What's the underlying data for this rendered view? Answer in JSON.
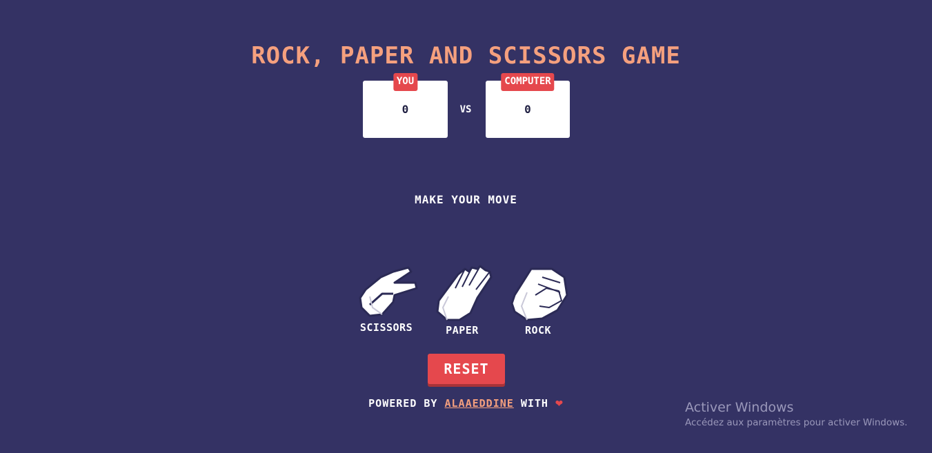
{
  "title": "ROCK, PAPER AND SCISSORS GAME",
  "scoreboard": {
    "user_label": "YOU",
    "user_score": "0",
    "vs": "VS",
    "computer_label": "COMPUTER",
    "computer_score": "0"
  },
  "message": "MAKE YOUR MOVE",
  "choices": [
    {
      "label": "SCISSORS",
      "icon": "scissors-hand-icon"
    },
    {
      "label": "PAPER",
      "icon": "paper-hand-icon"
    },
    {
      "label": "ROCK",
      "icon": "rock-fist-icon"
    }
  ],
  "reset_label": "RESET",
  "footer": {
    "prefix": "POWERED BY ",
    "author": "ALAAEDDINE",
    "suffix": " WITH ",
    "heart_icon": "heart-icon"
  },
  "watermark": {
    "title": "Activer Windows",
    "subtitle": "Accédez aux paramètres pour activer Windows."
  },
  "colors": {
    "background": "#343264",
    "accent": "#f5a07e",
    "badge": "#e5484d",
    "card": "#ffffff"
  }
}
